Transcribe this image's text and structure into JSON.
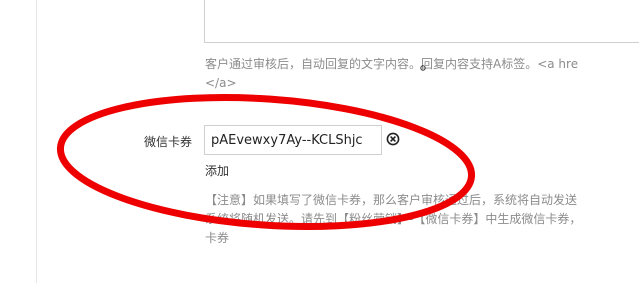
{
  "form": {
    "auto_reply_help": {
      "line1": "客户通过审核后，自动回复的文字内容。回复内容支持A标签。<a hre",
      "line2": "</a>"
    },
    "card_field": {
      "label": "微信卡券",
      "value": "pAEvewxy7Ay--KCLShjc",
      "remove_icon": "close-circle-icon",
      "add_label": "添加"
    },
    "card_help": {
      "line1": "【注意】如果填写了微信卡券，那么客户审核通过后，系统将自动发送",
      "line2": "系统将随机发送。请先到【粉丝营销】-【微信卡券】中生成微信卡券，",
      "line3": "卡券"
    }
  },
  "annotation": {
    "shape": "ellipse",
    "color": "#ee0000"
  }
}
